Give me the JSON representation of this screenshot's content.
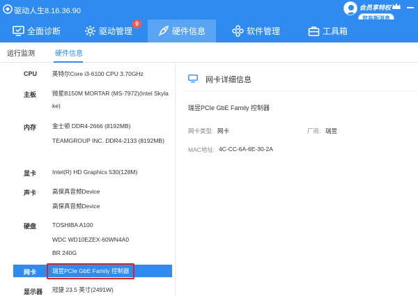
{
  "app": {
    "title": "驱动人生8.16.36.90"
  },
  "user": {
    "vip_label": "会员享特权",
    "message_label": "您有新消息"
  },
  "nav": {
    "items": [
      {
        "label": "全面诊断",
        "icon": "monitor-check-icon"
      },
      {
        "label": "驱动管理",
        "icon": "gear-icon",
        "badge": "9"
      },
      {
        "label": "硬件信息",
        "icon": "rocket-icon",
        "active": true
      },
      {
        "label": "软件管理",
        "icon": "apps-icon"
      },
      {
        "label": "工具箱",
        "icon": "toolbox-icon"
      }
    ]
  },
  "subtabs": [
    {
      "label": "运行监测"
    },
    {
      "label": "硬件信息",
      "active": true
    }
  ],
  "hardware": [
    {
      "label": "CPU",
      "values": [
        "英特尔Core i3-6100 CPU 3.70GHz"
      ]
    },
    {
      "label": "主板",
      "values": [
        "微星B150M MORTAR (MS-7972)(Intel Skylake)"
      ]
    },
    {
      "label": "内存",
      "values": [
        "金士顿 DDR4-2666 (8192MB)",
        "TEAMGROUP INC. DDR4-2133 (8192MB)"
      ]
    },
    {
      "label": "显卡",
      "values": [
        "Intel(R) HD Graphics 530(128M)"
      ]
    },
    {
      "label": "声卡",
      "values": [
        "高保真音频Device",
        "高保真音频Device"
      ]
    },
    {
      "label": "硬盘",
      "values": [
        "TOSHIBA A100",
        "WDC WD10EZEX-60WN4A0",
        "BR 240G"
      ]
    },
    {
      "label": "网卡",
      "values": [
        "瑞昱PCIe GbE Family 控制器"
      ],
      "selected": true
    },
    {
      "label": "显示器",
      "values": [
        "冠捷 23.5 英寸(2491W)"
      ]
    }
  ],
  "detail": {
    "title": "网卡详细信息",
    "device_name": "瑞昱PCIe GbE Family 控制器",
    "type_key": "网卡类型:",
    "type_value": "网卡",
    "vendor_key": "厂商:",
    "vendor_value": "瑞昱",
    "mac_key": "MAC地址:",
    "mac_value": "4C-CC-6A-6E-30-2A"
  },
  "colors": {
    "accent": "#2f8bef",
    "highlight_border": "#e02020",
    "badge": "#f05a4a"
  }
}
